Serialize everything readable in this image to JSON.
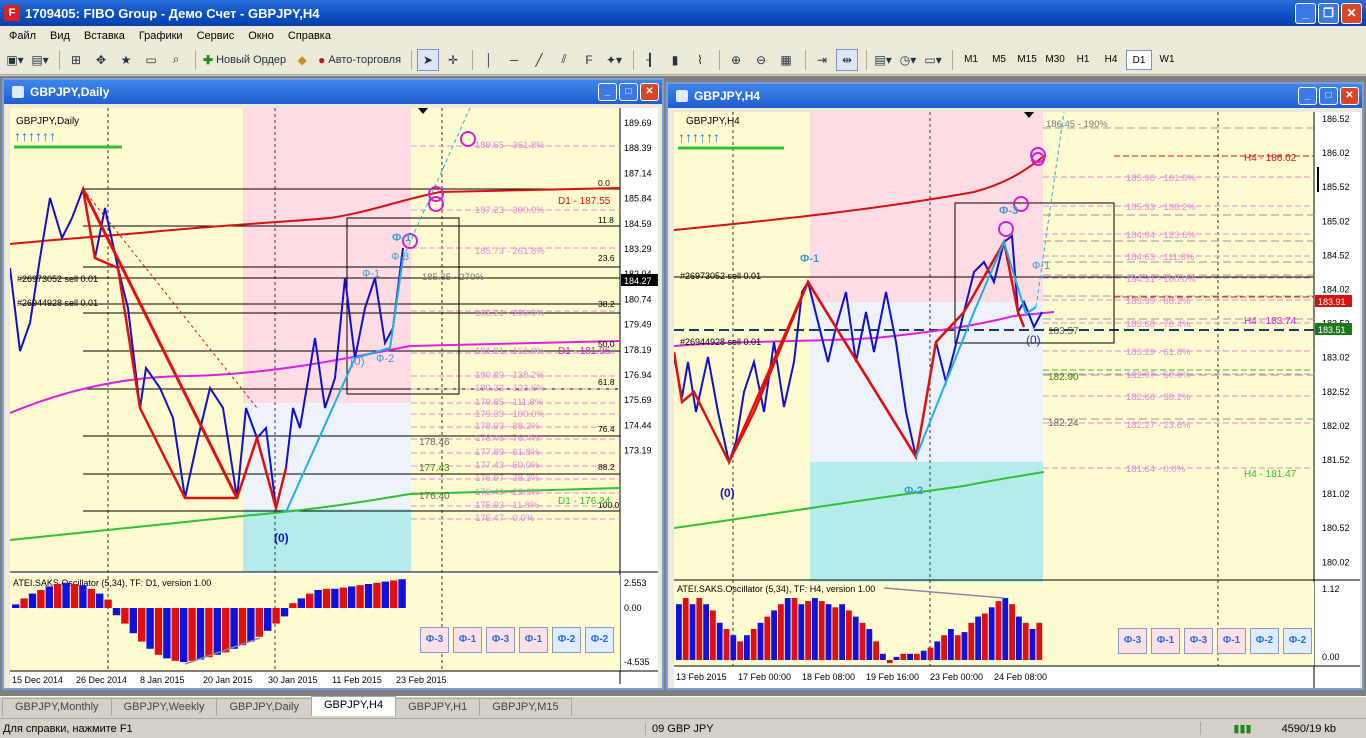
{
  "app": {
    "title": "1709405: FIBO Group - Демо Счет - GBPJPY,H4",
    "icon": "F"
  },
  "menu": [
    "Файл",
    "Вид",
    "Вставка",
    "Графики",
    "Сервис",
    "Окно",
    "Справка"
  ],
  "toolbar": {
    "new_order": "Новый Ордер",
    "auto_trading": "Авто-торговля",
    "timeframes": [
      "M1",
      "M5",
      "M15",
      "M30",
      "H1",
      "H4",
      "D1",
      "W1"
    ],
    "selected_timeframe": "D1"
  },
  "left_chart": {
    "window_title": "GBPJPY,Daily",
    "symbol_label": "GBPJPY,Daily",
    "price_axis": [
      "189.69",
      "188.39",
      "187.14",
      "185.84",
      "184.59",
      "183.29",
      "182.04",
      "180.74",
      "179.49",
      "178.19",
      "176.94",
      "175.69",
      "174.44",
      "173.19"
    ],
    "current_price": "184.27",
    "date_axis": [
      "15 Dec 2014",
      "26 Dec 2014",
      "8 Jan 2015",
      "20 Jan 2015",
      "30 Jan 2015",
      "11 Feb 2015",
      "23 Feb 2015"
    ],
    "sell_labels": [
      "#26973052 sell 0.01",
      "#26944928 sell 0.01"
    ],
    "fib_levels": [
      "189.65 - 361.8%",
      "187.23 - 300.0%",
      "185.73 - 261.8%",
      "185.35 - 270%",
      "183.31 - 200.0%",
      "181.81 - 161.8%",
      "180.89 - 138.2%",
      "180.32 - 123.6%",
      "179.85 - 111.8%",
      "179.39 - 100.0%",
      "178.93 - 88.2%",
      "178.46 - 76.4%",
      "177.89 - 61.8%",
      "177.43 - 50.0%",
      "176.97 - 38.2%",
      "176.40 - 23.6%",
      "175.93 - 11.8%",
      "175.47 - 0.0%"
    ],
    "fib_right": [
      "0.0",
      "11.8",
      "23.6",
      "38.2",
      "50.0",
      "61.8",
      "76.4",
      "88.2",
      "100.0"
    ],
    "d1_labels": [
      "D1 - 187.55",
      "D1 - 181.96",
      "D1 - 176.24"
    ],
    "green_values": [
      "178.46",
      "177.43",
      "176.40"
    ],
    "wave_labels": [
      "Ф-1",
      "Ф-3",
      "Ф-1",
      "Ф-2",
      "(0)",
      "(0)"
    ],
    "oscillator": {
      "label": "ATEI.SAKS.Oscillator (5,34), TF: D1, version 1.00",
      "axis": [
        "2.553",
        "0.00",
        "-4.535"
      ],
      "values": [
        0.3,
        0.8,
        1.2,
        1.5,
        1.8,
        2.0,
        2.1,
        2.0,
        1.9,
        1.6,
        1.2,
        0.7,
        -0.6,
        -1.3,
        -2.1,
        -2.8,
        -3.4,
        -3.9,
        -4.2,
        -4.4,
        -4.5,
        -4.4,
        -4.3,
        -4.1,
        -3.9,
        -3.7,
        -3.4,
        -3.1,
        -2.8,
        -2.4,
        -1.9,
        -1.3,
        -0.7,
        0.4,
        0.8,
        1.2,
        1.5,
        1.6,
        1.6,
        1.7,
        1.8,
        1.9,
        2.0,
        2.1,
        2.2,
        2.3,
        2.4
      ]
    }
  },
  "right_chart": {
    "window_title": "GBPJPY,H4",
    "symbol_label": "GBPJPY,H4",
    "price_axis": [
      "186.52",
      "186.02",
      "185.52",
      "185.02",
      "184.52",
      "184.02",
      "183.52",
      "183.02",
      "182.52",
      "182.02",
      "181.52",
      "181.02",
      "180.52",
      "180.02"
    ],
    "current_price_red": "183.91",
    "current_price_green": "183.51",
    "date_axis": [
      "13 Feb 2015",
      "17 Feb 00:00",
      "18 Feb 08:00",
      "19 Feb 16:00",
      "23 Feb 00:00",
      "24 Feb 08:00"
    ],
    "sell_labels": [
      "#26973052 sell 0.01",
      "#26944928 sell 0.01"
    ],
    "fib_levels": [
      "186.45 - 190%",
      "185.96 - 161.8%",
      "185.33 - 138.2%",
      "184.94 - 123.6%",
      "184.63 - 111.8%",
      "184.31 - 100.0%",
      "183.99 - 88.2%",
      "183.68 - 76.4%",
      "183.29 - 61.8%",
      "182.97 - 50.0%",
      "182.66 - 38.2%",
      "182.27 - 23.6%",
      "181.64 - 0.0%"
    ],
    "h4_labels": [
      "H4 - 186.02",
      "H4 - 183.74",
      "H4 - 181.47"
    ],
    "other_values": [
      "183.57",
      "182.90",
      "182.24"
    ],
    "wave_labels": [
      "Ф-1",
      "Ф-3",
      "Ф-1",
      "Ф-2",
      "(0)",
      "(0)"
    ],
    "oscillator": {
      "label": "ATEI.SAKS.Oscillator (5,34), TF: H4, version 1.00",
      "axis": [
        "1.12",
        "0.00"
      ],
      "values": [
        0.9,
        1.0,
        0.9,
        1.0,
        0.9,
        0.8,
        0.6,
        0.5,
        0.4,
        0.3,
        0.4,
        0.5,
        0.6,
        0.7,
        0.8,
        0.9,
        1.0,
        1.0,
        0.9,
        0.95,
        1.0,
        0.95,
        0.9,
        0.85,
        0.9,
        0.8,
        0.7,
        0.6,
        0.5,
        0.3,
        0.1,
        -0.05,
        0.05,
        0.1,
        0.1,
        0.1,
        0.15,
        0.2,
        0.3,
        0.4,
        0.5,
        0.4,
        0.45,
        0.6,
        0.7,
        0.75,
        0.85,
        0.95,
        1.0,
        0.9,
        0.7,
        0.6,
        0.5,
        0.6
      ]
    }
  },
  "phi_buttons": [
    "Ф-3",
    "Ф-1",
    "Ф-3",
    "Ф-1",
    "Ф-2",
    "Ф-2"
  ],
  "tabs": [
    "GBPJPY,Monthly",
    "GBPJPY,Weekly",
    "GBPJPY,Daily",
    "GBPJPY,H4",
    "GBPJPY,H1",
    "GBPJPY,M15"
  ],
  "active_tab": "GBPJPY,H4",
  "status": {
    "help": "Для справки, нажмите F1",
    "profile": "09 GBP JPY",
    "traffic": "4590/19 kb"
  },
  "colors": {
    "chart_bg_yellow": "#fffbd0",
    "pink_zone": "#ffdce4",
    "cyan_zone": "#b4ecec",
    "bull_line": "#1010c8",
    "bear_line": "#e01010",
    "fib_color": "#e08ae0",
    "ma_magenta": "#e020e0",
    "ma_red": "#d81010",
    "ma_green": "#30c030"
  }
}
